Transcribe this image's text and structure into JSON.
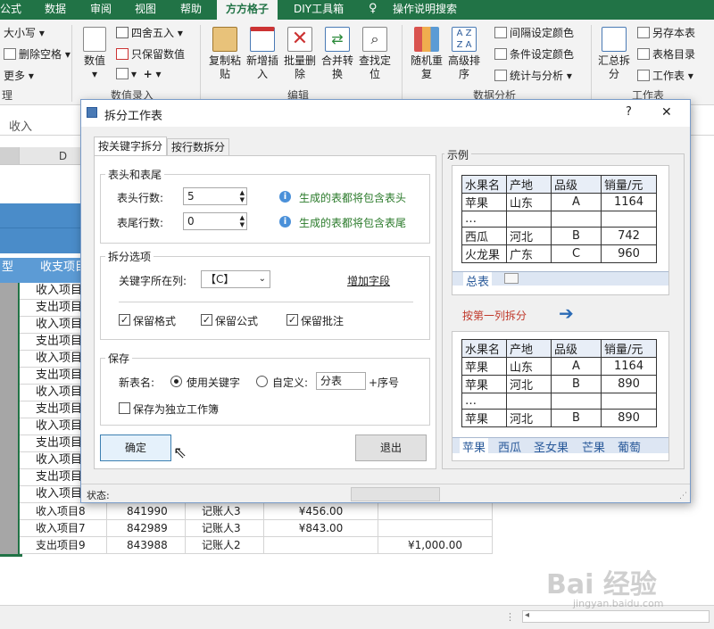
{
  "ribbon": {
    "tabs": [
      "公式",
      "数据",
      "审阅",
      "视图",
      "帮助",
      "方方格子",
      "DIY工具箱",
      "操作说明搜索"
    ],
    "left_items": [
      "大小写",
      "删除空格",
      "更多",
      "理"
    ],
    "buttons": {
      "value": "数值",
      "round": "四舍五入",
      "keep_value": "只保留数值",
      "copy_paste": "复制粘贴",
      "insert": "新增插入",
      "batch_delete": "批量删除",
      "merge_convert": "合并转换",
      "find_locate": "查找定位",
      "random_repeat": "随机重复",
      "advanced_sort": "高级排序",
      "interval_color": "间隔设定颜色",
      "cond_color": "条件设定颜色",
      "stats": "统计与分析",
      "summary_split": "汇总拆分",
      "save_as": "另存本表",
      "sheet_toc": "表格目录",
      "worksheet": "工作表"
    },
    "groups": {
      "value_entry": "数值录入",
      "edit": "编辑",
      "data_analysis": "数据分析",
      "worksheet": "工作表"
    }
  },
  "formula_bar": {
    "value": "收入"
  },
  "sheet": {
    "col_d": "D",
    "header_left": "型",
    "header_item": "收支项目",
    "left_items": [
      "收入项目",
      "支出项目",
      "收入项目",
      "支出项目",
      "收入项目",
      "支出项目",
      "收入项目",
      "支出项目",
      "收入项目",
      "支出项目",
      "收入项目",
      "支出项目",
      "收入项目"
    ],
    "bottom_rows": [
      {
        "item": "收入项目8",
        "code": "841990",
        "person": "记账人3",
        "income": "¥456.00",
        "expense": ""
      },
      {
        "item": "收入项目7",
        "code": "842989",
        "person": "记账人3",
        "income": "¥843.00",
        "expense": ""
      },
      {
        "item": "支出项目9",
        "code": "843988",
        "person": "记账人2",
        "income": "",
        "expense": "¥1,000.00"
      }
    ]
  },
  "dialog": {
    "title": "拆分工作表",
    "help": "?",
    "close": "✕",
    "tabs": [
      "按关键字拆分",
      "按行数拆分"
    ],
    "header_footer": {
      "legend": "表头和表尾",
      "header_label": "表头行数:",
      "header_value": "5",
      "header_hint": "生成的表都将包含表头",
      "footer_label": "表尾行数:",
      "footer_value": "0",
      "footer_hint": "生成的表都将包含表尾"
    },
    "split_options": {
      "legend": "拆分选项",
      "keyword_col_label": "关键字所在列:",
      "keyword_col_value": "【C】",
      "add_field": "增加字段",
      "keep_format": "保留格式",
      "keep_formula": "保留公式",
      "keep_comment": "保留批注"
    },
    "save": {
      "legend": "保存",
      "new_name_label": "新表名:",
      "use_keyword": "使用关键字",
      "custom": "自定义:",
      "custom_value": "分表",
      "suffix": "+序号",
      "save_independent": "保存为独立工作簿"
    },
    "ok": "确定",
    "exit": "退出",
    "status": "状态:",
    "example": {
      "legend": "示例",
      "top_table": {
        "headers": [
          "水果名",
          "产地",
          "品级",
          "销量/元"
        ],
        "rows": [
          [
            "苹果",
            "山东",
            "A",
            "1164"
          ],
          [
            "…",
            "",
            "",
            ""
          ],
          [
            "西瓜",
            "河北",
            "B",
            "742"
          ],
          [
            "火龙果",
            "广东",
            "C",
            "960"
          ]
        ]
      },
      "top_tab": "总表",
      "arrow_text": "按第一列拆分",
      "bottom_table": {
        "headers": [
          "水果名",
          "产地",
          "品级",
          "销量/元"
        ],
        "rows": [
          [
            "苹果",
            "山东",
            "A",
            "1164"
          ],
          [
            "苹果",
            "河北",
            "B",
            "890"
          ],
          [
            "…",
            "",
            "",
            ""
          ],
          [
            "苹果",
            "河北",
            "B",
            "890"
          ]
        ]
      },
      "bottom_tabs": [
        "苹果",
        "西瓜",
        "圣女果",
        "芒果",
        "葡萄"
      ]
    }
  },
  "watermark": {
    "text": "Bai 经验",
    "sub": "jingyan.baidu.com"
  }
}
